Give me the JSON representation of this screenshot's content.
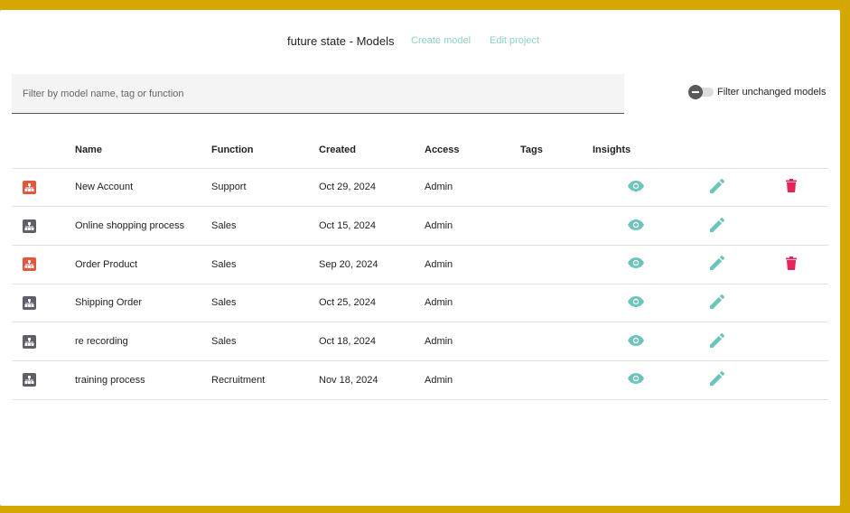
{
  "header": {
    "title": "future state - Models",
    "create_label": "Create model",
    "edit_label": "Edit project"
  },
  "search": {
    "placeholder": "Filter by model name, tag or function",
    "value": ""
  },
  "filter_toggle": {
    "label": "Filter unchanged models",
    "on": false
  },
  "table": {
    "columns": [
      "",
      "Name",
      "Function",
      "Created",
      "Access",
      "Tags",
      "Insights",
      "",
      ""
    ],
    "rows": [
      {
        "icon_color": "#e4573d",
        "name": "New Account",
        "function": "Support",
        "created": "Oct 29, 2024",
        "access": "Admin",
        "tags": "",
        "deletable": true
      },
      {
        "icon_color": "#5f5f6b",
        "name": "Online shopping process",
        "function": "Sales",
        "created": "Oct 15, 2024",
        "access": "Admin",
        "tags": "",
        "deletable": false
      },
      {
        "icon_color": "#e4573d",
        "name": "Order Product",
        "function": "Sales",
        "created": "Sep 20, 2024",
        "access": "Admin",
        "tags": "",
        "deletable": true
      },
      {
        "icon_color": "#5f5f6b",
        "name": "Shipping Order",
        "function": "Sales",
        "created": "Oct 25, 2024",
        "access": "Admin",
        "tags": "",
        "deletable": false
      },
      {
        "icon_color": "#5f5f6b",
        "name": "re recording",
        "function": "Sales",
        "created": "Oct 18, 2024",
        "access": "Admin",
        "tags": "",
        "deletable": false
      },
      {
        "icon_color": "#5f5f6b",
        "name": "training process",
        "function": "Recruitment",
        "created": "Nov 18, 2024",
        "access": "Admin",
        "tags": "",
        "deletable": false
      }
    ]
  },
  "icons": {
    "model": "hierarchy-icon",
    "insights": "eye-icon",
    "edit": "pencil-icon",
    "delete": "trash-icon"
  },
  "colors": {
    "background": "#d4a800",
    "accent": "#6cc4bb",
    "delete": "#e5245c",
    "model_changed": "#e4573d",
    "model_unchanged": "#5f5f6b"
  }
}
